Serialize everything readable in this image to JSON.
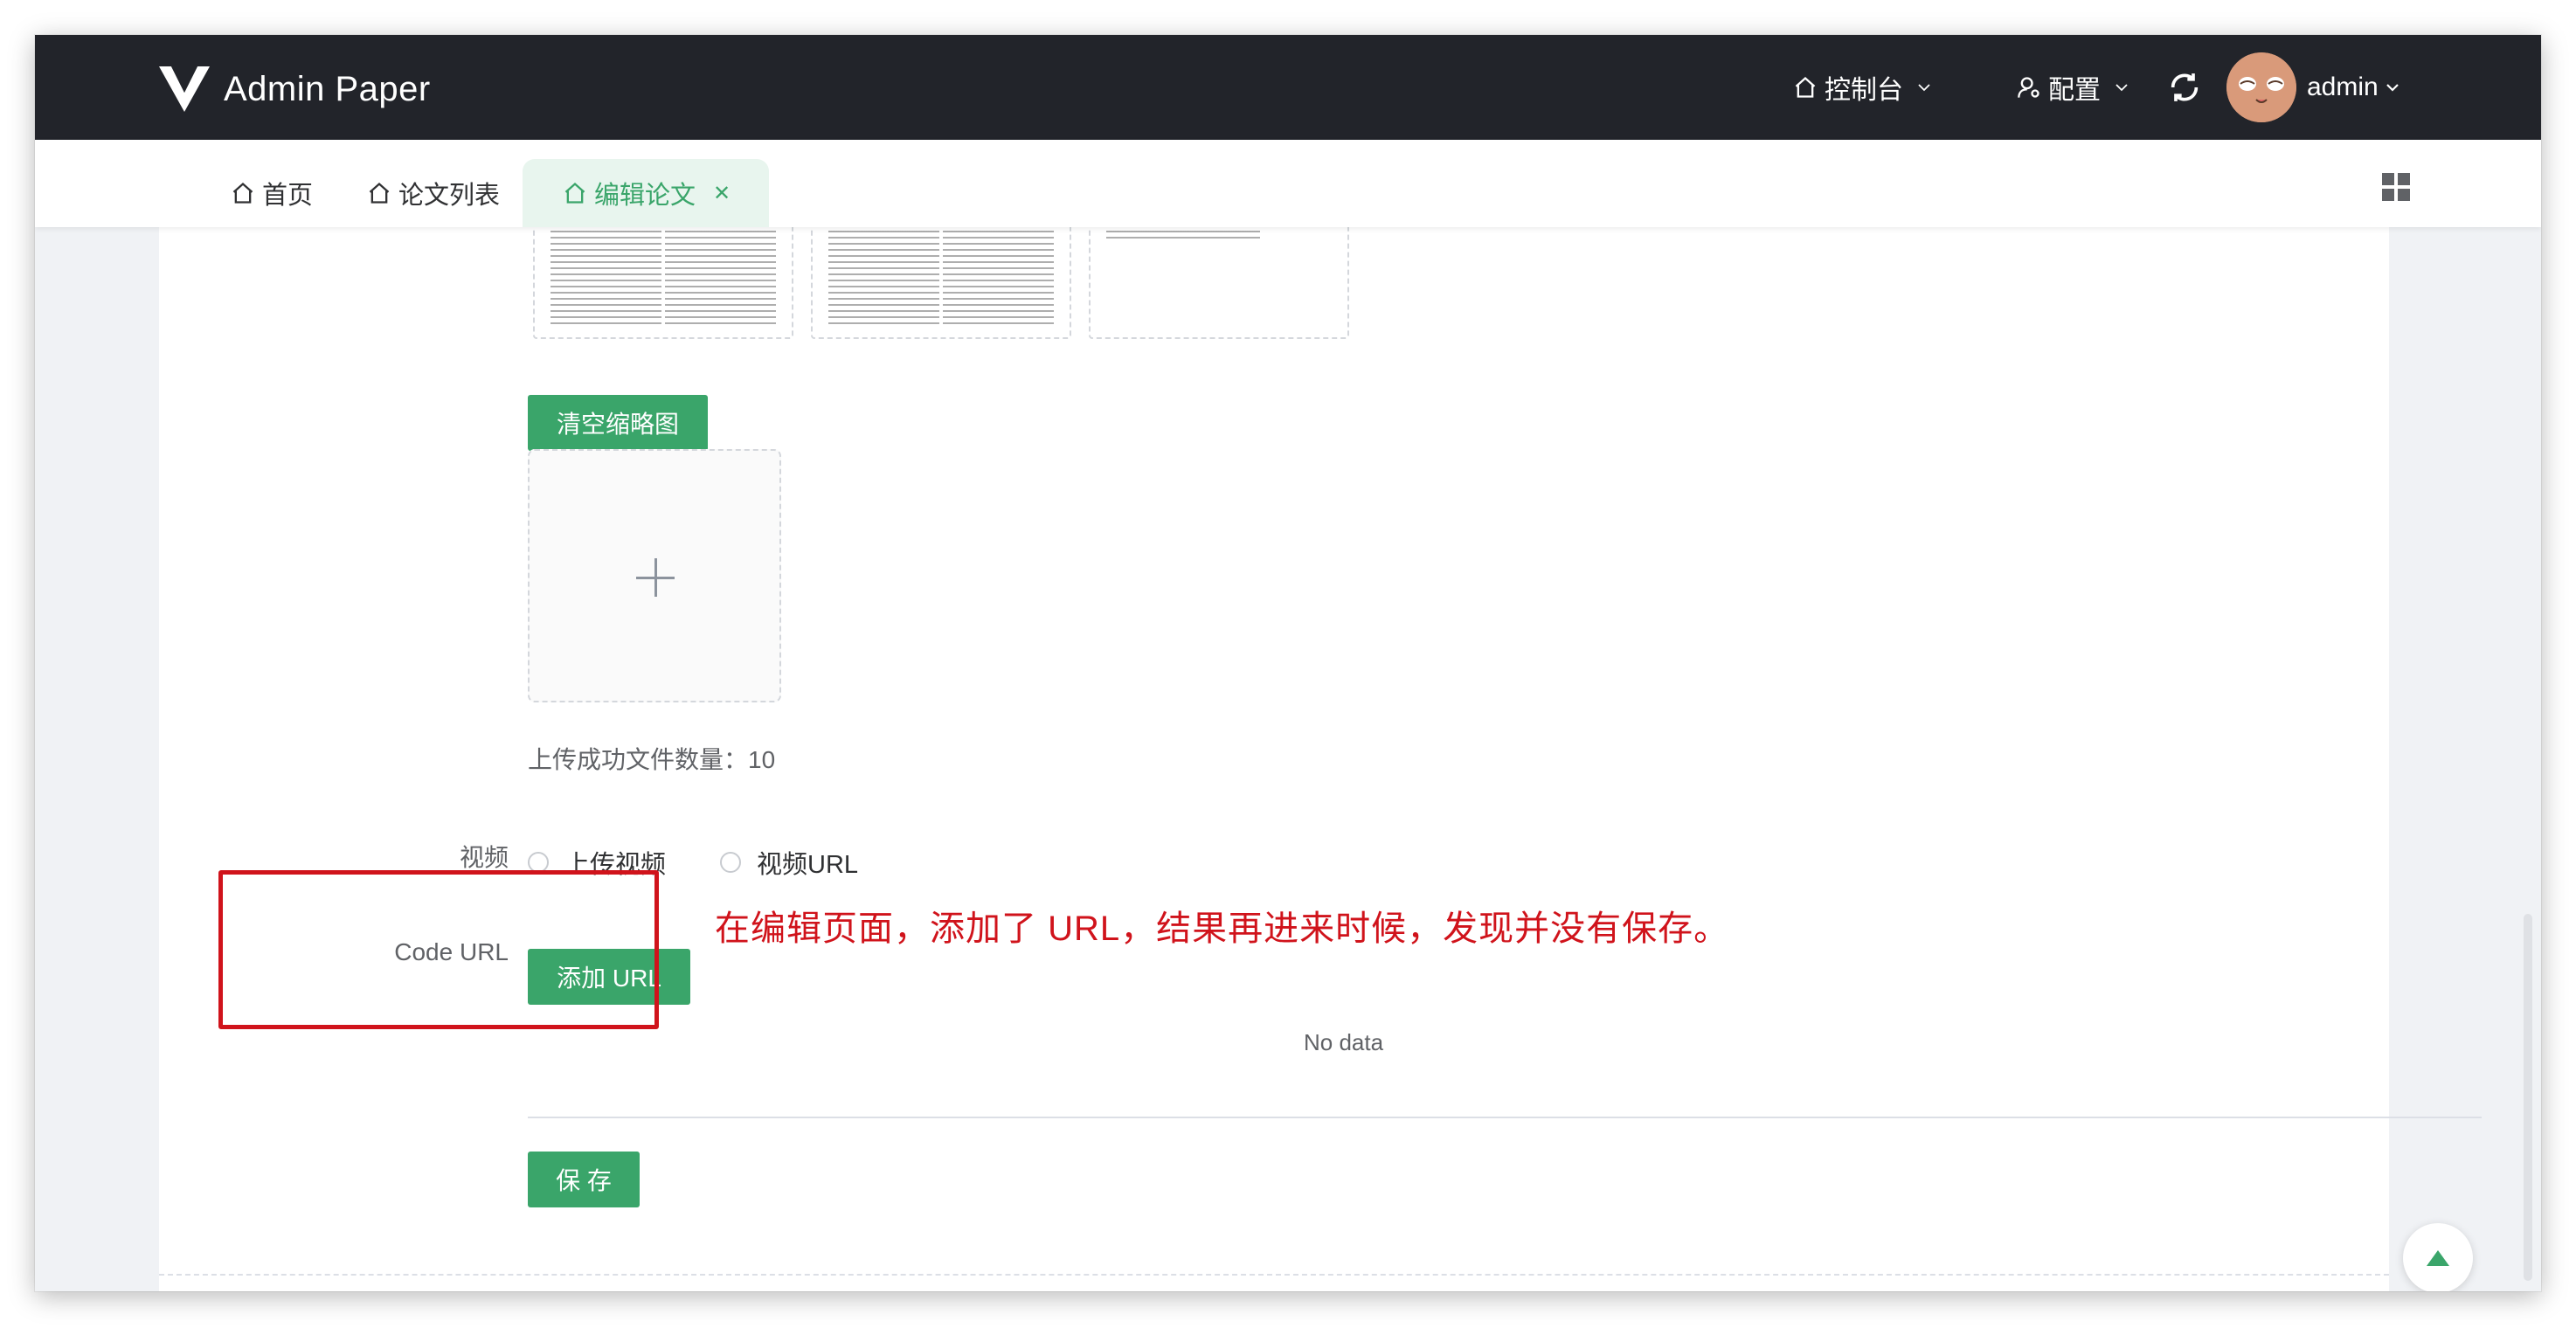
{
  "app": {
    "title": "Admin Paper"
  },
  "header": {
    "nav": [
      {
        "label": "控制台",
        "icon": "home-icon"
      },
      {
        "label": "配置",
        "icon": "user-settings-icon"
      }
    ],
    "user": {
      "name": "admin"
    }
  },
  "tabs": [
    {
      "label": "首页",
      "active": false
    },
    {
      "label": "论文列表",
      "active": false
    },
    {
      "label": "编辑论文",
      "active": true
    }
  ],
  "form": {
    "clear_thumbs_button": "清空缩略图",
    "upload_count_text": "上传成功文件数量：10",
    "video_label": "视频",
    "video_options": [
      "上传视频",
      "视频URL"
    ],
    "code_url_label": "Code URL",
    "add_url_button": "添加 URL",
    "empty_text": "No data",
    "save_button": "保 存"
  },
  "annotation": {
    "text": "在编辑页面，添加了 URL，结果再进来时候，发现并没有保存。",
    "color": "#d0131b"
  },
  "colors": {
    "primary": "#3aa56a",
    "header_bg": "#22242a"
  }
}
